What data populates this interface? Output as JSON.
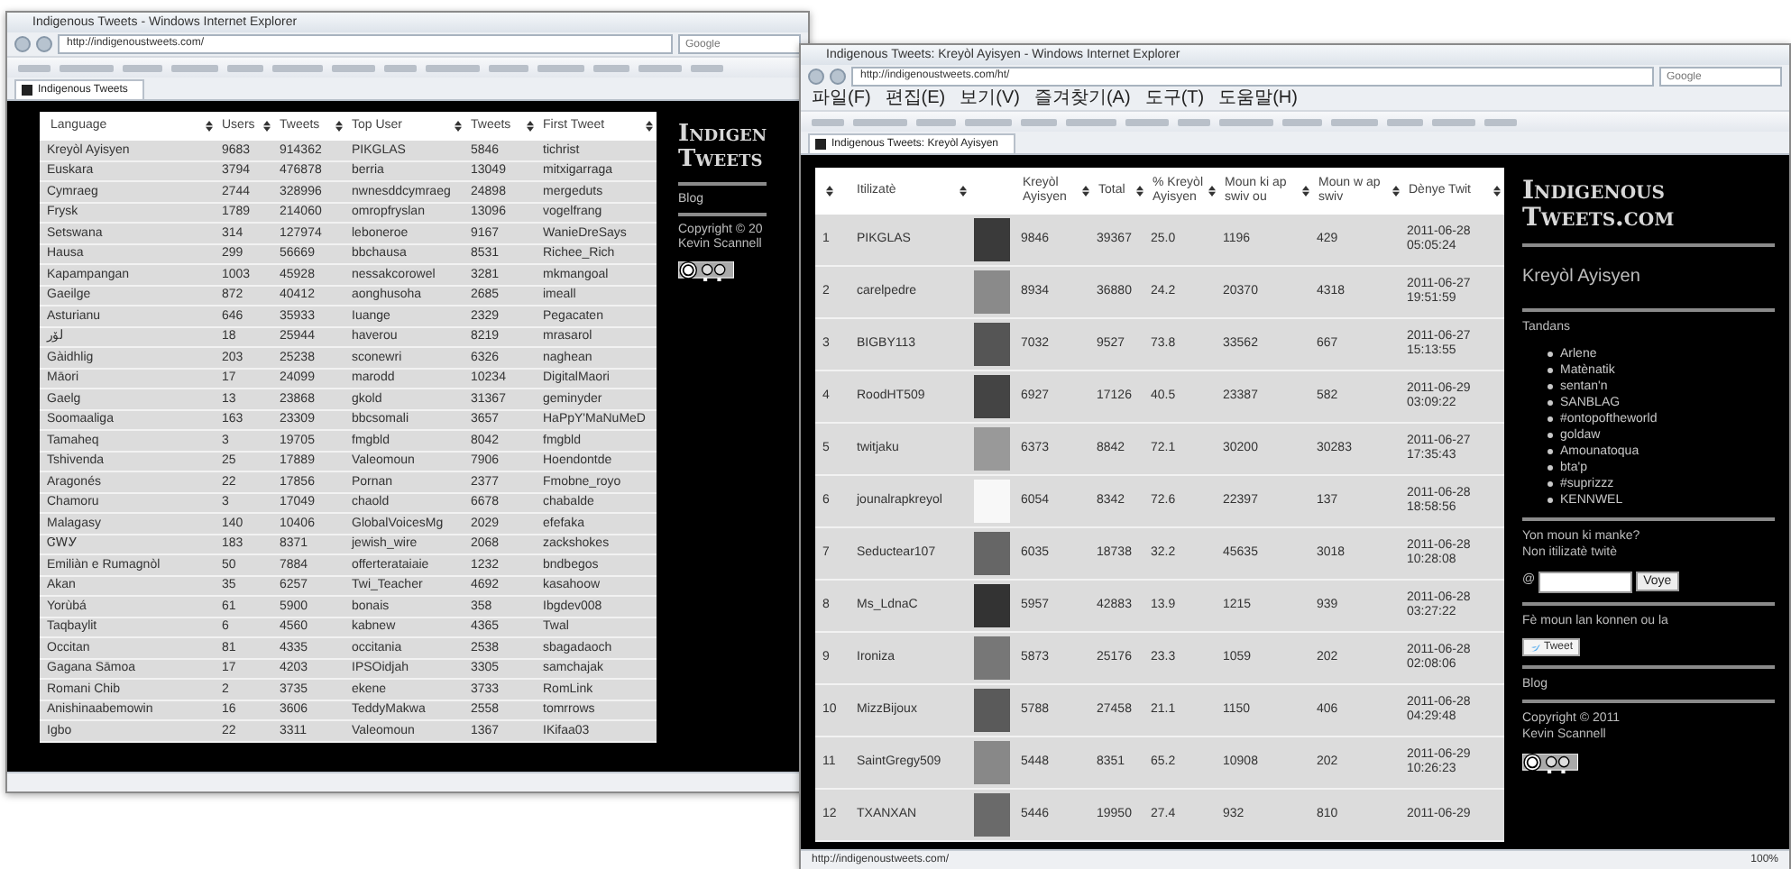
{
  "overview_window": {
    "title": "Indigenous Tweets - Windows Internet Explorer",
    "url": "http://indigenoustweets.com/",
    "search": {
      "placeholder": "Google"
    },
    "tab": "Indigenous Tweets",
    "table": {
      "columns": [
        "Language",
        "Users",
        "Tweets",
        "Top User",
        "Tweets",
        "First Tweet"
      ],
      "rows": [
        [
          "Kreyòl Ayisyen",
          "9683",
          "914362",
          "PIKGLAS",
          "5846",
          "tichrist"
        ],
        [
          "Euskara",
          "3794",
          "476878",
          "berria",
          "13049",
          "mitxigarraga"
        ],
        [
          "Cymraeg",
          "2744",
          "328996",
          "nwnesddcymraeg",
          "24898",
          "mergeduts"
        ],
        [
          "Frysk",
          "1789",
          "214060",
          "omropfryslan",
          "13096",
          "vogelfrang"
        ],
        [
          "Setswana",
          "314",
          "127974",
          "leboneroe",
          "9167",
          "WanieDreSays"
        ],
        [
          "Hausa",
          "299",
          "56669",
          "bbchausa",
          "8531",
          "Richee_Rich"
        ],
        [
          "Kapampangan",
          "1003",
          "45928",
          "nessakcorowel",
          "3281",
          "mkmangoal"
        ],
        [
          "Gaeilge",
          "872",
          "40412",
          "aonghusoha",
          "2685",
          "imeall"
        ],
        [
          "Asturianu",
          "646",
          "35933",
          "Iuange",
          "2329",
          "Pegacaten"
        ],
        [
          "لۆر",
          "18",
          "25944",
          "haverou",
          "8219",
          "mrasarol"
        ],
        [
          "Gàidhlig",
          "203",
          "25238",
          "sconewri",
          "6326",
          "naghean"
        ],
        [
          "Māori",
          "17",
          "24099",
          "marodd",
          "10234",
          "DigitalMaori"
        ],
        [
          "Gaelg",
          "13",
          "23868",
          "gkold",
          "31367",
          "geminyder"
        ],
        [
          "Soomaaliga",
          "163",
          "23309",
          "bbcsomali",
          "3657",
          "HaPpY'MaNuMeD"
        ],
        [
          "Tamaheq",
          "3",
          "19705",
          "fmgbld",
          "8042",
          "fmgbld"
        ],
        [
          "Tshivenda",
          "25",
          "17889",
          "Valeomoun",
          "7906",
          "Hoendontde"
        ],
        [
          "Aragonés",
          "22",
          "17856",
          "Pornan",
          "2377",
          "Fmobne_royo"
        ],
        [
          "Chamoru",
          "3",
          "17049",
          "chaold",
          "6678",
          "chabalde"
        ],
        [
          "Malagasy",
          "140",
          "10406",
          "GlobalVoicesMg",
          "2029",
          "efefaka"
        ],
        [
          "ᏣᎳᎩ",
          "183",
          "8371",
          "jewish_wire",
          "2068",
          "zackshokes"
        ],
        [
          "Emiliàn e Rumagnòl",
          "50",
          "7884",
          "offerterataiaie",
          "1232",
          "bndbegos"
        ],
        [
          "Akan",
          "35",
          "6257",
          "Twi_Teacher",
          "4692",
          "kasahoow"
        ],
        [
          "Yorùbá",
          "61",
          "5900",
          "bonais",
          "358",
          "Ibgdev008"
        ],
        [
          "Taqbaylit",
          "6",
          "4560",
          "kabnew",
          "4365",
          "Twal"
        ],
        [
          "Occitan",
          "81",
          "4335",
          "occitania",
          "2538",
          "sbagadaoch"
        ],
        [
          "Gagana Sāmoa",
          "17",
          "4203",
          "IPSOidjah",
          "3305",
          "samchajak"
        ],
        [
          "Romani Chib",
          "2",
          "3735",
          "ekene",
          "3733",
          "RomLink"
        ],
        [
          "Anishinaabemowin",
          "16",
          "3606",
          "TeddyMakwa",
          "2558",
          "tomrrows"
        ],
        [
          "Igbo",
          "22",
          "3311",
          "Valeomoun",
          "1367",
          "IKifaa03"
        ]
      ]
    },
    "sidebar": {
      "logo": [
        "Indigen",
        "Tweets"
      ],
      "link": "Blog",
      "copyright": "Copyright © 20",
      "author": "Kevin Scannell"
    }
  },
  "language_window": {
    "title": "Indigenous Tweets: Kreyòl Ayisyen - Windows Internet Explorer",
    "url": "http://indigenoustweets.com/ht/",
    "search": {
      "placeholder": "Google"
    },
    "menu": [
      "파일(F)",
      "편집(E)",
      "보기(V)",
      "즐겨찾기(A)",
      "도구(T)",
      "도움말(H)"
    ],
    "tab": "Indigenous Tweets: Kreyòl Ayisyen",
    "table": {
      "columns": [
        "",
        "Itilizatè",
        "",
        "Kreyòl Ayisyen",
        "Total",
        "% Kreyòl Ayisyen",
        "Moun ki ap swiv ou",
        "Moun w ap swiv",
        "Dènye Twit"
      ],
      "rows": [
        {
          "rank": "1",
          "user": "PIKGLAS",
          "values": [
            "9846",
            "39367",
            "25.0",
            "1196",
            "429"
          ],
          "last": [
            "2011-06-28",
            "05:05:24"
          ]
        },
        {
          "rank": "2",
          "user": "carelpedre",
          "values": [
            "8934",
            "36880",
            "24.2",
            "20370",
            "4318"
          ],
          "last": [
            "2011-06-27",
            "19:51:59"
          ]
        },
        {
          "rank": "3",
          "user": "BIGBY113",
          "values": [
            "7032",
            "9527",
            "73.8",
            "33562",
            "667"
          ],
          "last": [
            "2011-06-27",
            "15:13:55"
          ]
        },
        {
          "rank": "4",
          "user": "RoodHT509",
          "values": [
            "6927",
            "17126",
            "40.5",
            "23387",
            "582"
          ],
          "last": [
            "2011-06-29",
            "03:09:22"
          ]
        },
        {
          "rank": "5",
          "user": "twitjaku",
          "values": [
            "6373",
            "8842",
            "72.1",
            "30200",
            "30283"
          ],
          "last": [
            "2011-06-27",
            "17:35:43"
          ]
        },
        {
          "rank": "6",
          "user": "jounalrapkreyol",
          "values": [
            "6054",
            "8342",
            "72.6",
            "22397",
            "137"
          ],
          "last": [
            "2011-06-28",
            "18:58:56"
          ]
        },
        {
          "rank": "7",
          "user": "Seductear107",
          "values": [
            "6035",
            "18738",
            "32.2",
            "45635",
            "3018"
          ],
          "last": [
            "2011-06-28",
            "10:28:08"
          ]
        },
        {
          "rank": "8",
          "user": "Ms_LdnaC",
          "values": [
            "5957",
            "42883",
            "13.9",
            "1215",
            "939"
          ],
          "last": [
            "2011-06-28",
            "03:27:22"
          ]
        },
        {
          "rank": "9",
          "user": "Ironiza",
          "values": [
            "5873",
            "25176",
            "23.3",
            "1059",
            "202"
          ],
          "last": [
            "2011-06-28",
            "02:08:06"
          ]
        },
        {
          "rank": "10",
          "user": "MizzBijoux",
          "values": [
            "5788",
            "27458",
            "21.1",
            "1150",
            "406"
          ],
          "last": [
            "2011-06-28",
            "04:29:48"
          ]
        },
        {
          "rank": "11",
          "user": "SaintGregy509",
          "values": [
            "5448",
            "8351",
            "65.2",
            "10908",
            "202"
          ],
          "last": [
            "2011-06-29",
            "10:26:23"
          ]
        },
        {
          "rank": "12",
          "user": "TXANXAN",
          "values": [
            "5446",
            "19950",
            "27.4",
            "932",
            "810"
          ],
          "last": [
            "2011-06-29"
          ]
        }
      ]
    },
    "sidebar": {
      "logo": [
        "Indigenous",
        "Tweets.com"
      ],
      "language": "Kreyòl Ayisyen",
      "trends_title": "Tandans",
      "trends": [
        "Arlene",
        "Matènatik",
        "sentan'n",
        "SANBLAG",
        "#ontopoftheworld",
        "goldaw",
        "Amounatoqua",
        "bta'p",
        "#suprizzz",
        "KENNWEL"
      ],
      "missing": [
        "Yon moun ki manke?",
        "Non itilizatè twitè"
      ],
      "at": "@",
      "send": "Voye",
      "share": "Fè moun lan konnen ou la",
      "tweet": "Tweet",
      "link": "Blog",
      "copyright": "Copyright © 2011",
      "author": "Kevin Scannell"
    },
    "status_url": "http://indigenoustweets.com/",
    "zoom": "100%"
  }
}
